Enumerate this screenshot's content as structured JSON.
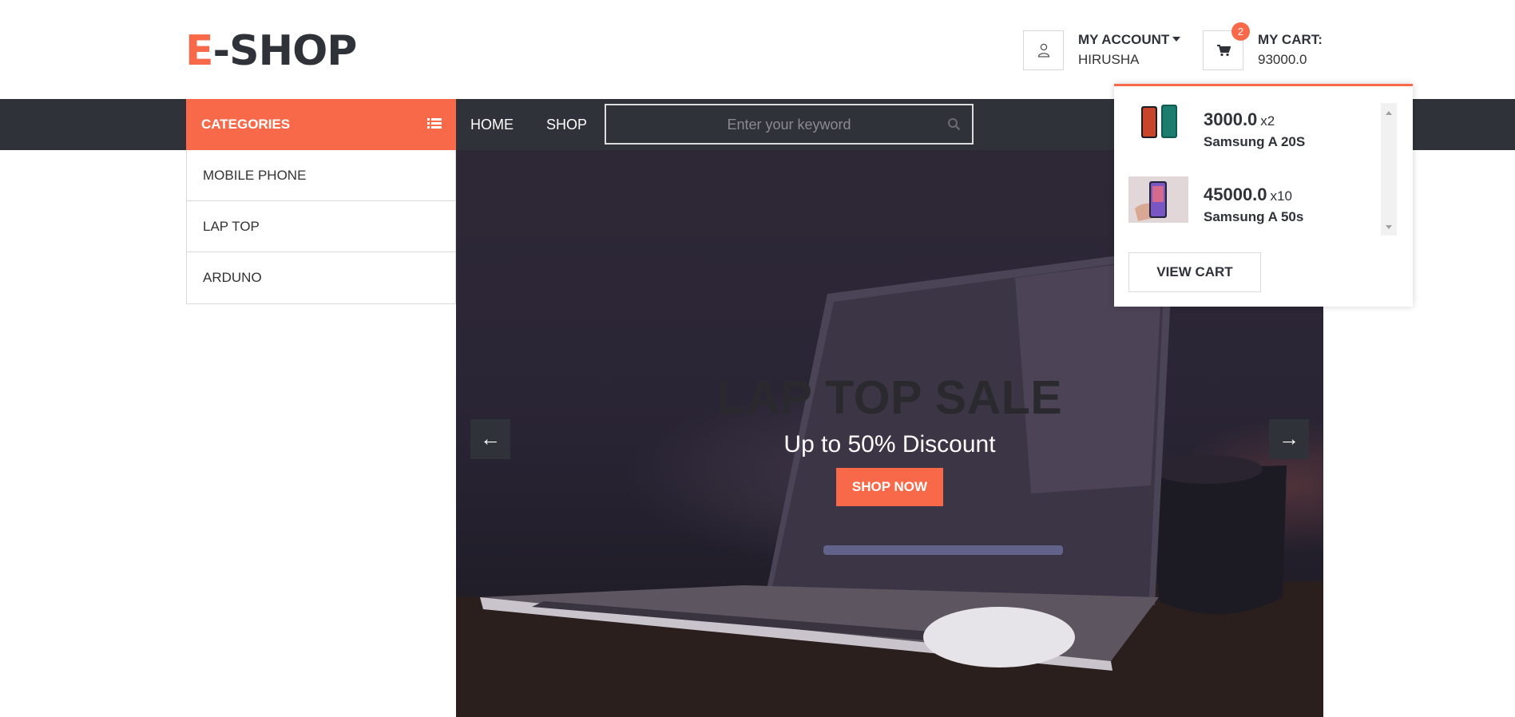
{
  "header": {
    "logo_accent": "E",
    "logo_rest": "-SHOP",
    "account_title": "MY ACCOUNT",
    "account_user": "HIRUSHA",
    "cart_title": "MY CART:",
    "cart_total": "93000.0",
    "cart_count": "2"
  },
  "nav": {
    "categories_label": "CATEGORIES",
    "links": [
      "HOME",
      "SHOP"
    ],
    "search_placeholder": "Enter your keyword"
  },
  "categories": [
    "MOBILE PHONE",
    "LAP TOP",
    "ARDUNO"
  ],
  "hero": {
    "title": "LAP TOP SALE",
    "subtitle": "Up to 50% Discount",
    "cta": "SHOP NOW",
    "prev": "←",
    "next": "→"
  },
  "cart_dropdown": {
    "items": [
      {
        "price": "3000.0",
        "qty": "x2",
        "name": "Samsung A 20S"
      },
      {
        "price": "45000.0",
        "qty": "x10",
        "name": "Samsung A 50s"
      }
    ],
    "view_cart": "VIEW CART"
  },
  "colors": {
    "accent": "#f8694a",
    "dark": "#30323a"
  },
  "icons": [
    "user-icon",
    "cart-icon",
    "list-icon",
    "search-icon",
    "arrow-left-icon",
    "arrow-right-icon"
  ]
}
